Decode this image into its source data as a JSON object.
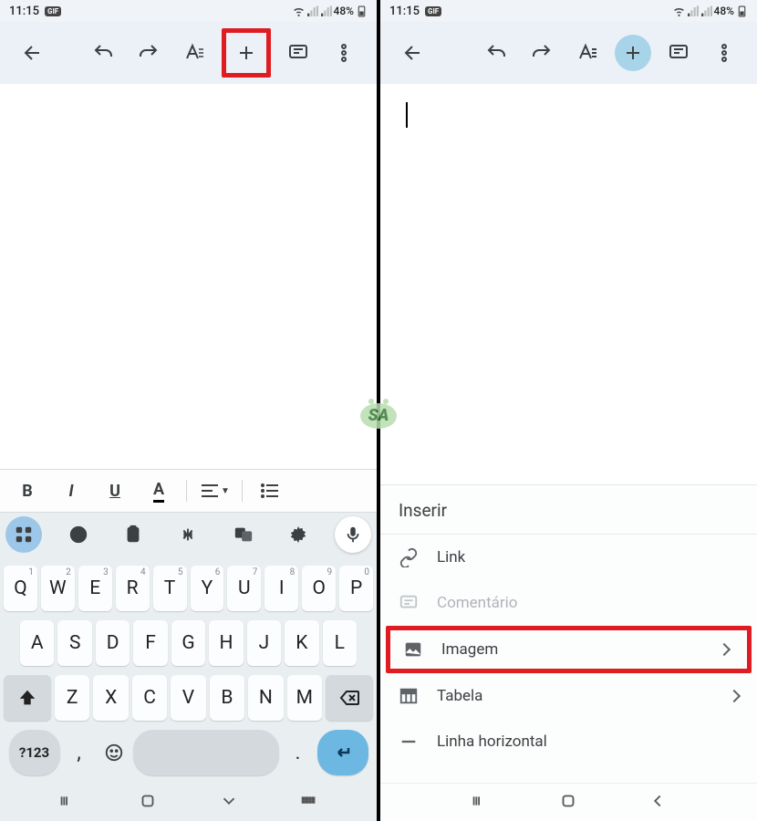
{
  "status": {
    "time": "11:15",
    "pill": "GIF",
    "battery": "48%"
  },
  "toolbar": {
    "back": "back-icon",
    "undo": "undo-icon",
    "redo": "redo-icon",
    "textformat": "text-format-icon",
    "insert": "plus-icon",
    "comment": "comment-icon",
    "more": "more-icon"
  },
  "format": {
    "bold": "B",
    "italic": "I",
    "underline": "U",
    "textcolor": "A",
    "align": "align-icon",
    "list": "list-icon"
  },
  "keyboard": {
    "row1": [
      {
        "k": "Q",
        "sup": "1"
      },
      {
        "k": "W",
        "sup": "2"
      },
      {
        "k": "E",
        "sup": "3"
      },
      {
        "k": "R",
        "sup": "4"
      },
      {
        "k": "T",
        "sup": "5"
      },
      {
        "k": "Y",
        "sup": "6"
      },
      {
        "k": "U",
        "sup": "7"
      },
      {
        "k": "I",
        "sup": "8"
      },
      {
        "k": "O",
        "sup": "9"
      },
      {
        "k": "P",
        "sup": "0"
      }
    ],
    "row2": [
      "A",
      "S",
      "D",
      "F",
      "G",
      "H",
      "J",
      "K",
      "L"
    ],
    "row3": [
      "Z",
      "X",
      "C",
      "V",
      "B",
      "N",
      "M"
    ],
    "symbols_key": "?123",
    "comma": ",",
    "period": "."
  },
  "insert_menu": {
    "title": "Inserir",
    "items": {
      "link": "Link",
      "comment": "Comentário",
      "image": "Imagem",
      "table": "Tabela",
      "hr": "Linha horizontal"
    }
  },
  "watermark_text": "SA"
}
